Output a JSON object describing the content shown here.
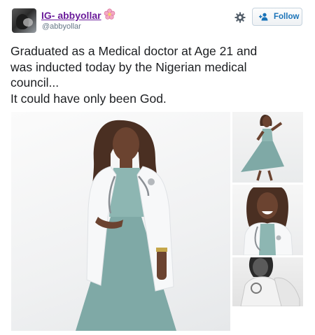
{
  "tweet": {
    "author": {
      "display_name": "IG- abbyollar",
      "name_emoji": "flower-emoji",
      "username": "@abbyollar"
    },
    "actions": {
      "settings_icon": "gear-icon",
      "follow_icon": "add-user-icon",
      "follow_label": "Follow"
    },
    "text_lines": [
      "Graduated as a Medical doctor at Age 21 and",
      "was inducted today by the Nigerian medical",
      "council...",
      "It could have only been God."
    ],
    "media": {
      "photo_count": 4
    }
  },
  "colors": {
    "display_name": "#6a1b9a",
    "follow_text": "#1a73b8",
    "username": "#657786",
    "dress": "#7fa9a6"
  }
}
